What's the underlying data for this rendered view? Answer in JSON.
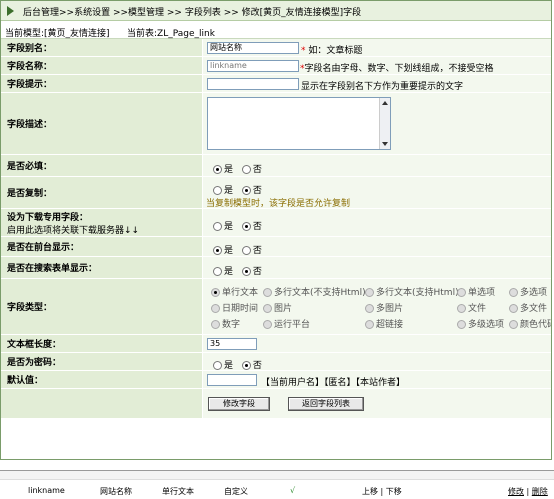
{
  "breadcrumb": "后台管理>>系统设置 >>模型管理 >> 字段列表 >> 修改[黄页_友情连接模型]字段",
  "model_bar": {
    "current_model": "当前模型:[黄页_友情连接]",
    "current_table": "当前表:ZL_Page_link"
  },
  "fields": {
    "alias": {
      "label": "字段别名：",
      "value": "网站名称",
      "star": "*",
      "hint": "如：文章标题"
    },
    "name": {
      "label": "字段名称：",
      "value": "linkname",
      "star": "*",
      "hint": "字段名由字母、数字、下划线组成，不接受空格"
    },
    "tip": {
      "label": "字段提示：",
      "value": "",
      "hint": "显示在字段别名下方作为重要提示的文字"
    },
    "desc": {
      "label": "字段描述："
    },
    "required": {
      "label": "是否必填：",
      "yes": "是",
      "no": "否"
    },
    "copy": {
      "label": "是否复制：",
      "yes": "是",
      "no": "否",
      "note": "当复制模型时，该字段是否允许复制"
    },
    "download": {
      "label": "设为下载专用字段：",
      "sub": "启用此选项将关联下载服务器↓↓",
      "yes": "是",
      "no": "否"
    },
    "front": {
      "label": "是否在前台显示：",
      "yes": "是",
      "no": "否"
    },
    "search": {
      "label": "是否在搜索表单显示：",
      "yes": "是",
      "no": "否"
    },
    "type": {
      "label": "字段类型：",
      "options": [
        [
          "单行文本",
          "多行文本(不支持Html)",
          "多行文本(支持Html)",
          "单选项",
          "多选项"
        ],
        [
          "日期时间",
          "图片",
          "多图片",
          "文件",
          "多文件"
        ],
        [
          "数字",
          "运行平台",
          "超链接",
          "多级选项",
          "颜色代码"
        ]
      ]
    },
    "length": {
      "label": "文本框长度：",
      "value": "35"
    },
    "password": {
      "label": "是否为密码：",
      "yes": "是",
      "no": "否"
    },
    "default": {
      "label": "默认值：",
      "value": "",
      "hint": "【当前用户名】【匿名】【本站作者】"
    }
  },
  "buttons": {
    "save": "修改字段",
    "back": "返回字段列表"
  },
  "bottom_row": {
    "field": "linkname",
    "alias": "网站名称",
    "type": "单行文本",
    "kind": "自定义",
    "check": "√",
    "order": "上移 | 下移",
    "edit": "修改",
    "sep": "|",
    "delete": "删除"
  }
}
